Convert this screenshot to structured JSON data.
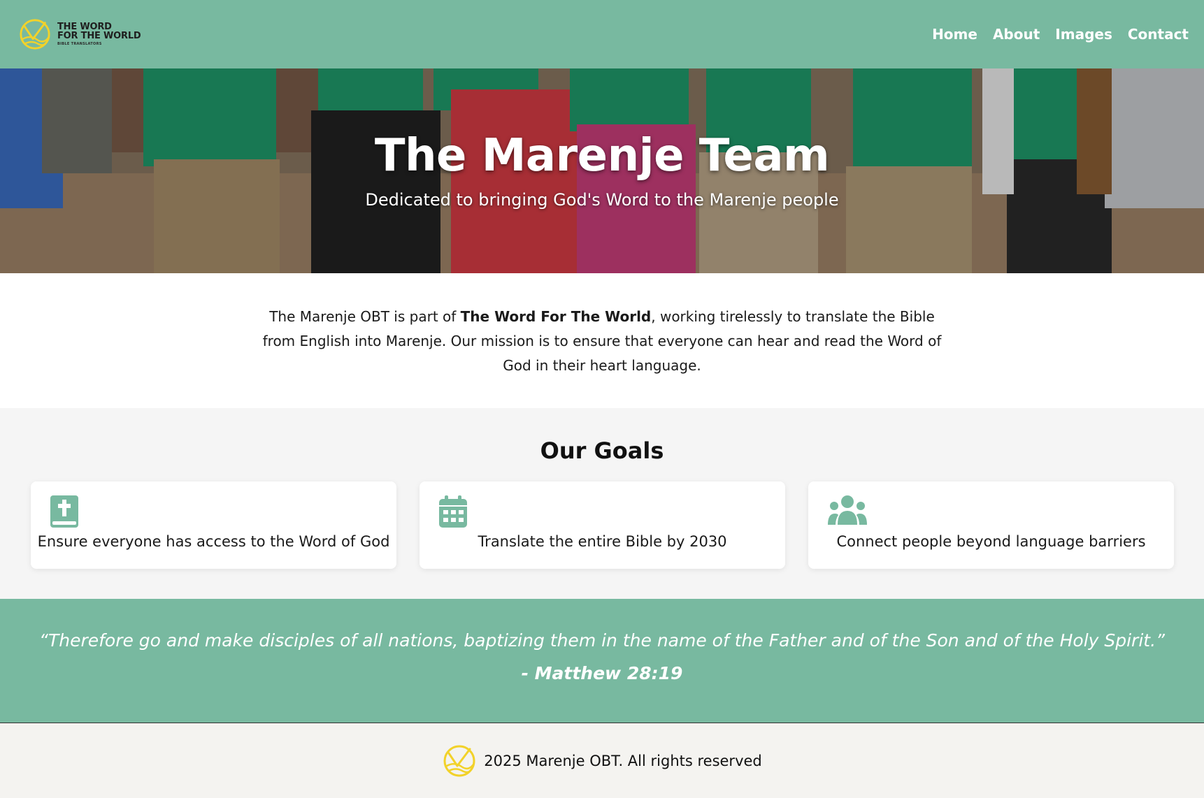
{
  "header": {
    "brand": {
      "line1": "THE WORD",
      "line2": "FOR THE WORLD",
      "line3": "BIBLE TRANSLATORS",
      "logo_icon": "twftw-logo-icon",
      "logo_color": "#f2d22a"
    },
    "nav": [
      "Home",
      "About",
      "Images",
      "Contact"
    ],
    "background_color": "#78b9a0"
  },
  "hero": {
    "title": "The Marenje Team",
    "subtitle": "Dedicated to bringing God's Word to the Marenje people",
    "image_icon": "team-photo"
  },
  "intro": {
    "before_bold": "The Marenje OBT is part of ",
    "bold": "The Word For The World",
    "after_bold": ", working tirelessly to translate the Bible from English into Marenje. Our mission is to ensure that everyone can hear and read the Word of God in their heart language."
  },
  "goals": {
    "title": "Our Goals",
    "icon_color": "#78b9a0",
    "items": [
      {
        "icon": "bible-icon",
        "text": "Ensure everyone has access to the Word of God"
      },
      {
        "icon": "calendar-icon",
        "text": "Translate the entire Bible by 2030"
      },
      {
        "icon": "people-group-icon",
        "text": "Connect people beyond language barriers"
      }
    ]
  },
  "quote": {
    "text": "“Therefore go and make disciples of all nations, baptizing them in the name of the Father and of the Son and of the Holy Spirit.”",
    "reference": "- Matthew 28:19"
  },
  "footer": {
    "text": "2025 Marenje OBT. All rights reserved",
    "logo_icon": "twftw-logo-icon"
  }
}
